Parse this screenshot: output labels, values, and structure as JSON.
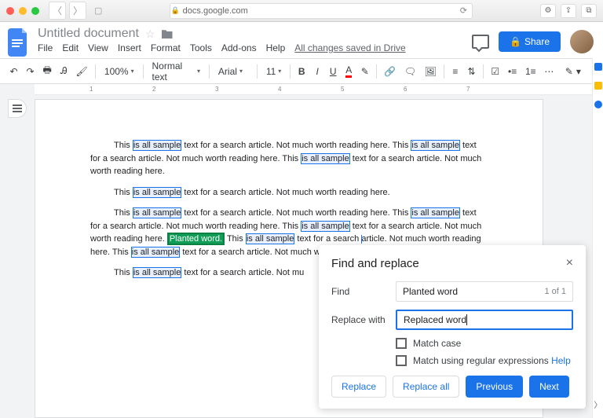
{
  "browser": {
    "url": "docs.google.com",
    "icons": [
      "gear-icon",
      "share-icon",
      "tabs-icon"
    ]
  },
  "header": {
    "title": "Untitled document",
    "menus": [
      "File",
      "Edit",
      "View",
      "Insert",
      "Format",
      "Tools",
      "Add-ons",
      "Help"
    ],
    "status": "All changes saved in Drive",
    "share_label": "Share"
  },
  "toolbar": {
    "zoom": "100%",
    "style": "Normal text",
    "font": "Arial",
    "size": "11",
    "text_color": "A"
  },
  "document": {
    "p1": "This is all sample text for a search article. Not much worth reading here. This is all sample text for a search article. Not much worth reading here. This is all sample text for a search article. Not much worth reading here.",
    "p2": "This is all sample text for a search article. Not much worth reading here.",
    "p3_pre": "This is all sample text for a search article. Not much worth reading here. This is all sample text for a search article. Not much worth reading here. This is all sample text for a search article. Not much worth reading here. ",
    "planted": "Planted word.",
    "p3_post": " This is all sample text for a search article. Not much worth reading here. This is all sample text for a search article. Not much worth reading here.",
    "p4": "This is all sample text for a search article. Not mu"
  },
  "dialog": {
    "title": "Find and replace",
    "find_label": "Find",
    "find_value": "Planted word",
    "find_count": "1 of 1",
    "replace_label": "Replace with",
    "replace_value": "Replaced word",
    "match_case": "Match case",
    "regex": "Match using regular expressions ",
    "help": "Help",
    "buttons": {
      "replace": "Replace",
      "replace_all": "Replace all",
      "previous": "Previous",
      "next": "Next"
    }
  }
}
